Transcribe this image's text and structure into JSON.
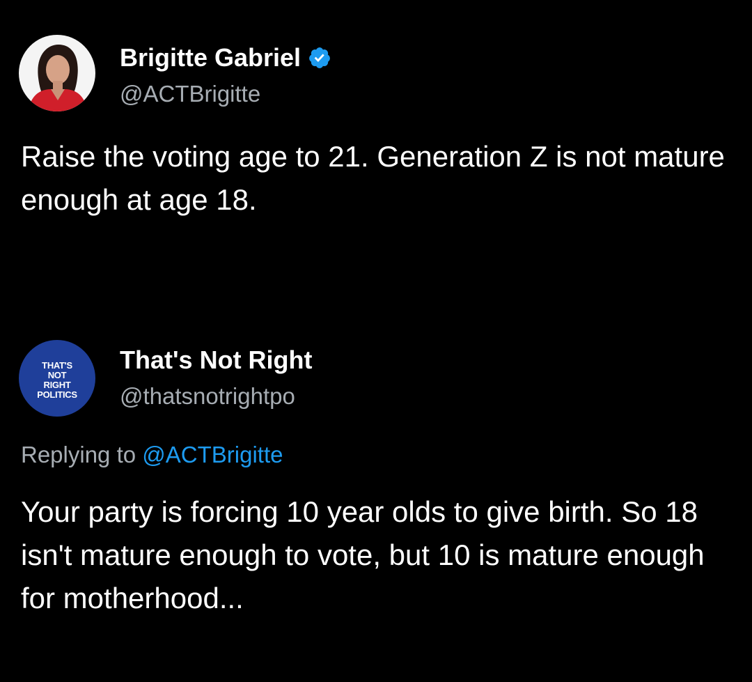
{
  "original_tweet": {
    "display_name": "Brigitte Gabriel",
    "verified": true,
    "handle": "@ACTBrigitte",
    "avatar": "portrait-photo",
    "text": "Raise the voting age to 21. Generation Z is not mature enough at age 18."
  },
  "reply_tweet": {
    "display_name": "That's Not Right",
    "handle": "@thatsnotrightpo",
    "avatar": "thats-not-right-politics-logo",
    "avatar_logo_lines": [
      "THAT'S",
      "NOT",
      "RIGHT",
      "POLITICS"
    ],
    "replying_prefix": "Replying to",
    "replying_handle": "@ACTBrigitte",
    "text": "Your party is forcing 10 year olds to give birth. So 18 isn't mature enough to vote, but 10 is mature enough for motherhood..."
  },
  "colors": {
    "background": "#000000",
    "text_primary": "#ffffff",
    "text_secondary": "#a7adb3",
    "accent": "#1d9bf0",
    "logo_background": "#1f3f9a"
  }
}
